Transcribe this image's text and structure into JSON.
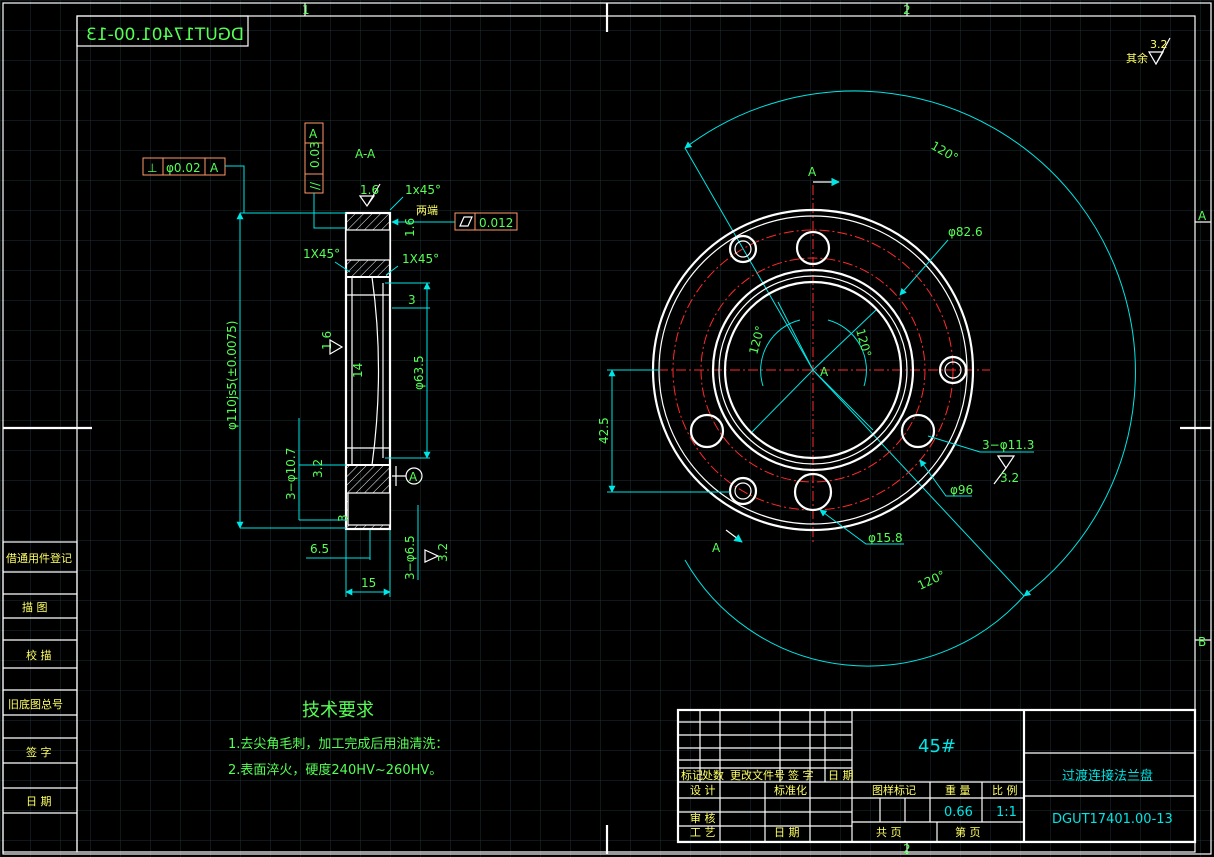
{
  "sheet": {
    "zones_top": [
      "1",
      "2"
    ],
    "zones_bottom": [
      "2"
    ],
    "zones_right": [
      "A",
      "B"
    ],
    "stamp_code": "DGUT17401.00-13",
    "roughness_note": "其余",
    "roughness_value": "3.2"
  },
  "section": {
    "title": "A-A",
    "perp_tol_symbol": "⊥",
    "perp_tol_value": "φ0.02",
    "datum_a": "A",
    "parallel_tol_symbol": "//",
    "parallel_tol_value": "0.03",
    "flat_tol_value": "0.012",
    "dim_chamfer_top": "1x45°",
    "dim_chamfer_left": "1X45°",
    "dim_chamfer_right": "1X45°",
    "rough_top": "1.6",
    "rough_right": "1.6",
    "rough_inner": "1.6",
    "note_both_ends": "两端",
    "dim_diam_outer": "φ110js5(±0.0075)",
    "dim_diam_inner": "φ63.5",
    "dim_3": "3",
    "dim_14": "14",
    "dim_holes_107": "3−φ10.7",
    "rough_107": "3.2",
    "datum_label": "A",
    "dim_65": "6.5",
    "dim_15": "15",
    "dim_holes_65": "3−φ6.5",
    "rough_65": "3.2",
    "dim_3_small": "3"
  },
  "plan": {
    "angle_top": "120°",
    "angle_bottom": "120°",
    "angle_inner_left": "120°",
    "angle_inner_right": "120°",
    "section_mark_top": "A",
    "section_mark_bottom": "A",
    "center_label": "A",
    "dim_826": "φ82.6",
    "dim_425": "42.5",
    "dim_holes_113": "3−φ11.3",
    "rough_113": "3.2",
    "dim_96": "φ96",
    "dim_158": "φ15.8"
  },
  "tech_req": {
    "title": "技术要求",
    "line1": "1.去尖角毛刺，加工完成后用油清洗：",
    "line2": "2.表面淬火，硬度240HV~260HV。"
  },
  "side_table": [
    "借通用件登记",
    "描 图",
    "校 描",
    "旧底图总号",
    "签 字",
    "日 期"
  ],
  "title_block": {
    "material": "45#",
    "part_name": "过渡连接法兰盘",
    "drawing_no": "DGUT17401.00-13",
    "rev_headers": [
      "标记",
      "处数",
      "更改文件号",
      "签 字",
      "日 期"
    ],
    "design": "设 计",
    "std": "标准化",
    "check": "审 核",
    "process": "工 艺",
    "date": "日 期",
    "stage_mark": "图样标记",
    "weight": "重 量",
    "scale": "比 例",
    "weight_val": "0.66",
    "scale_val": "1:1",
    "sheets_total": "共 页",
    "sheet_no": "第 页"
  },
  "colors": {
    "frame": "#ffffff",
    "dimension": "#00e5e5",
    "centerline": "#ff2a2a",
    "text": "#55ff55",
    "tolerance_box": "#ff9966"
  }
}
